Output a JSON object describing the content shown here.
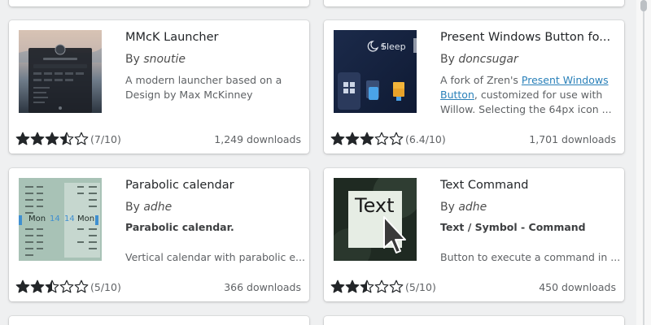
{
  "cards": [
    {
      "title": "MMcK Launcher",
      "by": "By",
      "author": "snoutie",
      "description": "A modern launcher based on a Design by Max McKinney",
      "rating_text": "(7/10)",
      "rating_value": 7,
      "downloads": "1,249 downloads"
    },
    {
      "title": "Present Windows Button fo...",
      "by": "By",
      "author": "doncsugar",
      "desc_pre": "A fork of Zren's ",
      "desc_link": "Present Windows Button",
      "desc_post": ", customized for use with Willow. Selecting the 64px icon ...",
      "thumb_text": "Sleep",
      "rating_text": "(6.4/10)",
      "rating_value": 6.4,
      "downloads": "1,701 downloads"
    },
    {
      "title": "Parabolic calendar",
      "by": "By",
      "author": "adhe",
      "subtitle": "Parabolic calendar.",
      "description": "Vertical calendar with parabolic e...",
      "thumb_left_day": "Mon",
      "thumb_left_num": "14",
      "thumb_right_num": "14",
      "thumb_right_day": "Mon",
      "rating_text": "(5/10)",
      "rating_value": 5,
      "downloads": "366 downloads"
    },
    {
      "title": "Text Command",
      "by": "By",
      "author": "adhe",
      "subtitle": "Text / Symbol - Command",
      "description": "Button to execute a command in ...",
      "thumb_text": "Text",
      "rating_text": "(5/10)",
      "rating_value": 5,
      "downloads": "450 downloads"
    }
  ],
  "colors": {
    "star": "#232629",
    "link": "#2980b9",
    "page_bg": "#eff0f1"
  }
}
